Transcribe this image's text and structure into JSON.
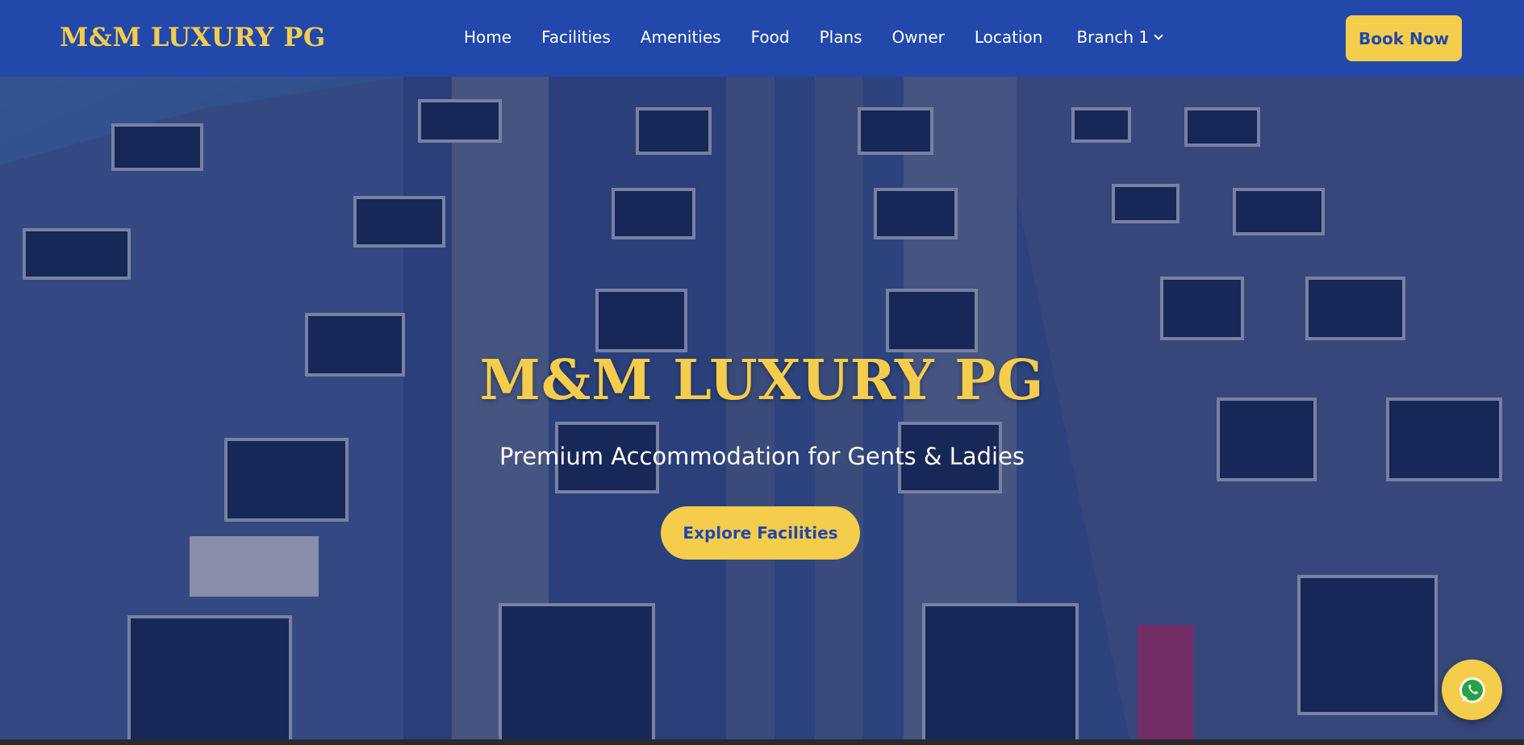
{
  "header": {
    "brand": "M&M LUXURY PG",
    "nav": [
      "Home",
      "Facilities",
      "Amenities",
      "Food",
      "Plans",
      "Owner",
      "Location"
    ],
    "branch_dropdown": "Branch 1",
    "book_button": "Book Now"
  },
  "hero": {
    "title": "M&M LUXURY PG",
    "subtitle": "Premium Accommodation for Gents & Ladies",
    "cta": "Explore Facilities"
  },
  "floating": {
    "whatsapp_icon": "whatsapp-icon"
  },
  "colors": {
    "primary": "#2248ac",
    "accent": "#f5cd4c",
    "text_light": "#ffffff"
  }
}
